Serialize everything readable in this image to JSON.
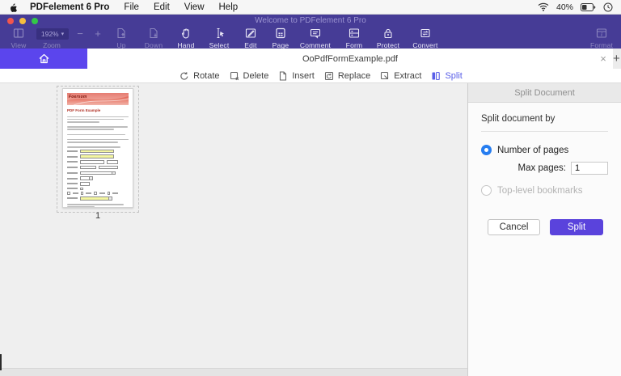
{
  "menubar": {
    "app_name": "PDFelement 6 Pro",
    "items": [
      "File",
      "Edit",
      "View",
      "Help"
    ],
    "status": {
      "battery_percent": "40%"
    }
  },
  "titlebar": {
    "title": "Welcome to PDFelement 6 Pro"
  },
  "toolbar": {
    "zoom_value": "192%",
    "zoom_out": "−",
    "zoom_in": "+",
    "chevron": "▾",
    "items": [
      {
        "label": "View"
      },
      {
        "label": "Zoom"
      },
      {
        "label": "Up"
      },
      {
        "label": "Down"
      },
      {
        "label": "Hand"
      },
      {
        "label": "Select"
      },
      {
        "label": "Edit"
      },
      {
        "label": "Page"
      },
      {
        "label": "Comment"
      },
      {
        "label": "Form"
      },
      {
        "label": "Protect"
      },
      {
        "label": "Convert"
      },
      {
        "label": "Format"
      }
    ]
  },
  "tabbar": {
    "filename": "OoPdfFormExample.pdf",
    "close": "×",
    "add": "+"
  },
  "pagetools": {
    "items": [
      {
        "label": "Rotate"
      },
      {
        "label": "Delete"
      },
      {
        "label": "Insert"
      },
      {
        "label": "Replace"
      },
      {
        "label": "Extract"
      },
      {
        "label": "Split"
      }
    ]
  },
  "thumbnail": {
    "page_number": "1",
    "logo_text": "Foersom",
    "doc_title": "PDF Form Example"
  },
  "panel": {
    "title": "Split Document",
    "section_label": "Split document by",
    "option_pages": "Number of pages",
    "option_bookmarks": "Top-level bookmarks",
    "max_pages_label": "Max pages:",
    "max_pages_value": "1",
    "cancel_label": "Cancel",
    "split_label": "Split"
  },
  "colors": {
    "toolbar_purple": "#463c96",
    "home_indigo": "#5b45ed",
    "split_button": "#5a43dc",
    "radio_blue": "#267df0",
    "split_tool_accent": "#5a5fe8"
  }
}
